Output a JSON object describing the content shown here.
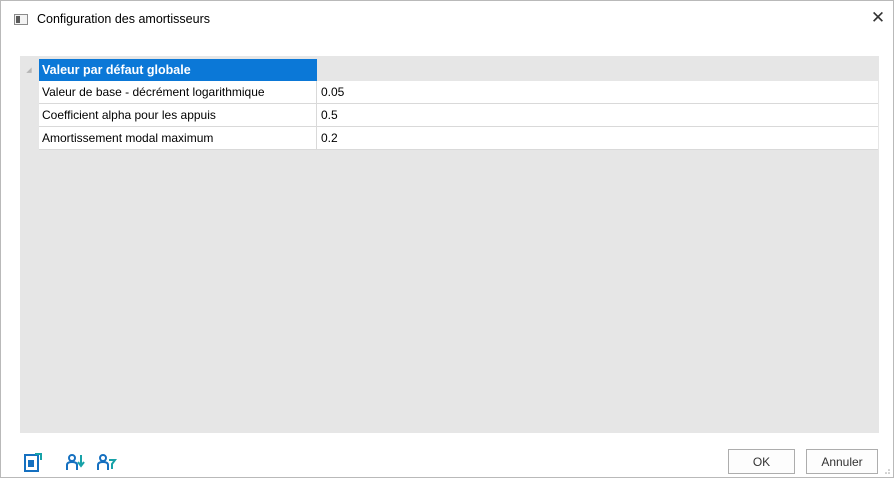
{
  "window": {
    "title": "Configuration des amortisseurs",
    "close_glyph": "✕"
  },
  "grid": {
    "group": {
      "label": "Valeur par défaut globale",
      "expander_glyph": "◢"
    },
    "rows": [
      {
        "name": "Valeur de base - décrément logarithmique",
        "value": "0.05"
      },
      {
        "name": "Coefficient alpha pour les appuis",
        "value": "0.5"
      },
      {
        "name": "Amortissement modal maximum",
        "value": "0.2"
      }
    ]
  },
  "toolbar": {
    "icons": [
      "document-edit-icon",
      "sort-users-icon",
      "filter-users-icon"
    ]
  },
  "buttons": {
    "ok": "OK",
    "cancel": "Annuler"
  },
  "colors": {
    "accent": "#0b78d7",
    "icon_blue": "#1570c0",
    "icon_teal": "#17a2a8"
  }
}
